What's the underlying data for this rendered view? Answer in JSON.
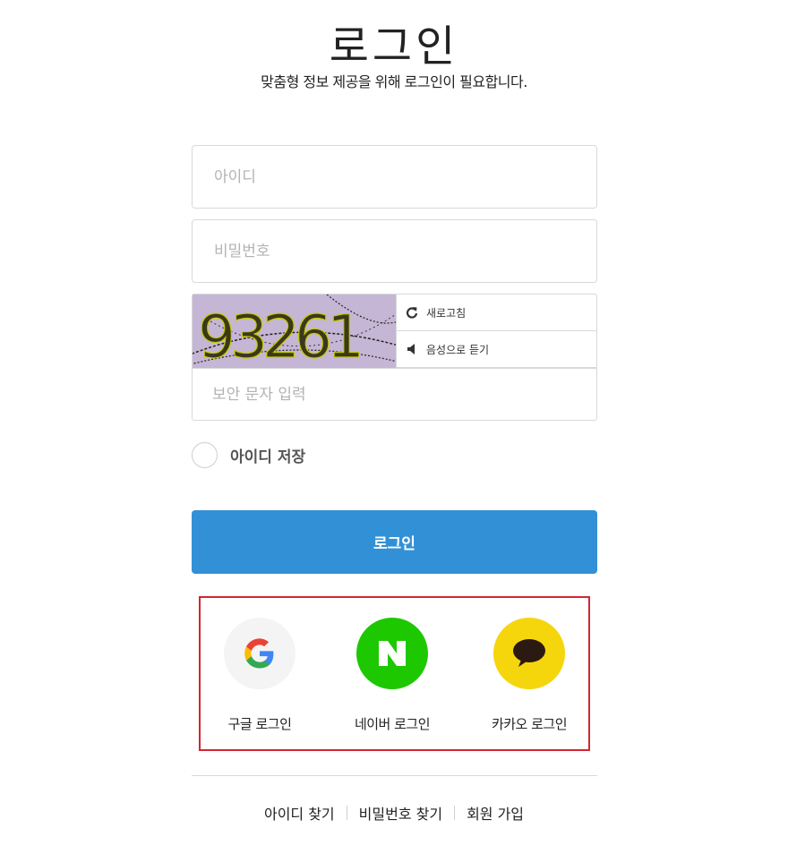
{
  "title": "로그인",
  "subtitle": "맞춤형 정보 제공을 위해 로그인이 필요합니다.",
  "form": {
    "id_placeholder": "아이디",
    "password_placeholder": "비밀번호",
    "captcha": {
      "image_text": "93261",
      "refresh_label": "새로고침",
      "audio_label": "음성으로 듣기",
      "input_placeholder": "보안 문자 입력"
    },
    "save_id_label": "아이디 저장",
    "login_button": "로그인"
  },
  "social": {
    "google_label": "구글 로그인",
    "naver_label": "네이버 로그인",
    "kakao_label": "카카오 로그인"
  },
  "links": {
    "find_id": "아이디 찾기",
    "find_password": "비밀번호 찾기",
    "signup": "회원 가입"
  },
  "colors": {
    "primary": "#3291d6",
    "naver": "#1ec800",
    "kakao": "#f5d60c",
    "highlight_border": "#d3262f"
  }
}
